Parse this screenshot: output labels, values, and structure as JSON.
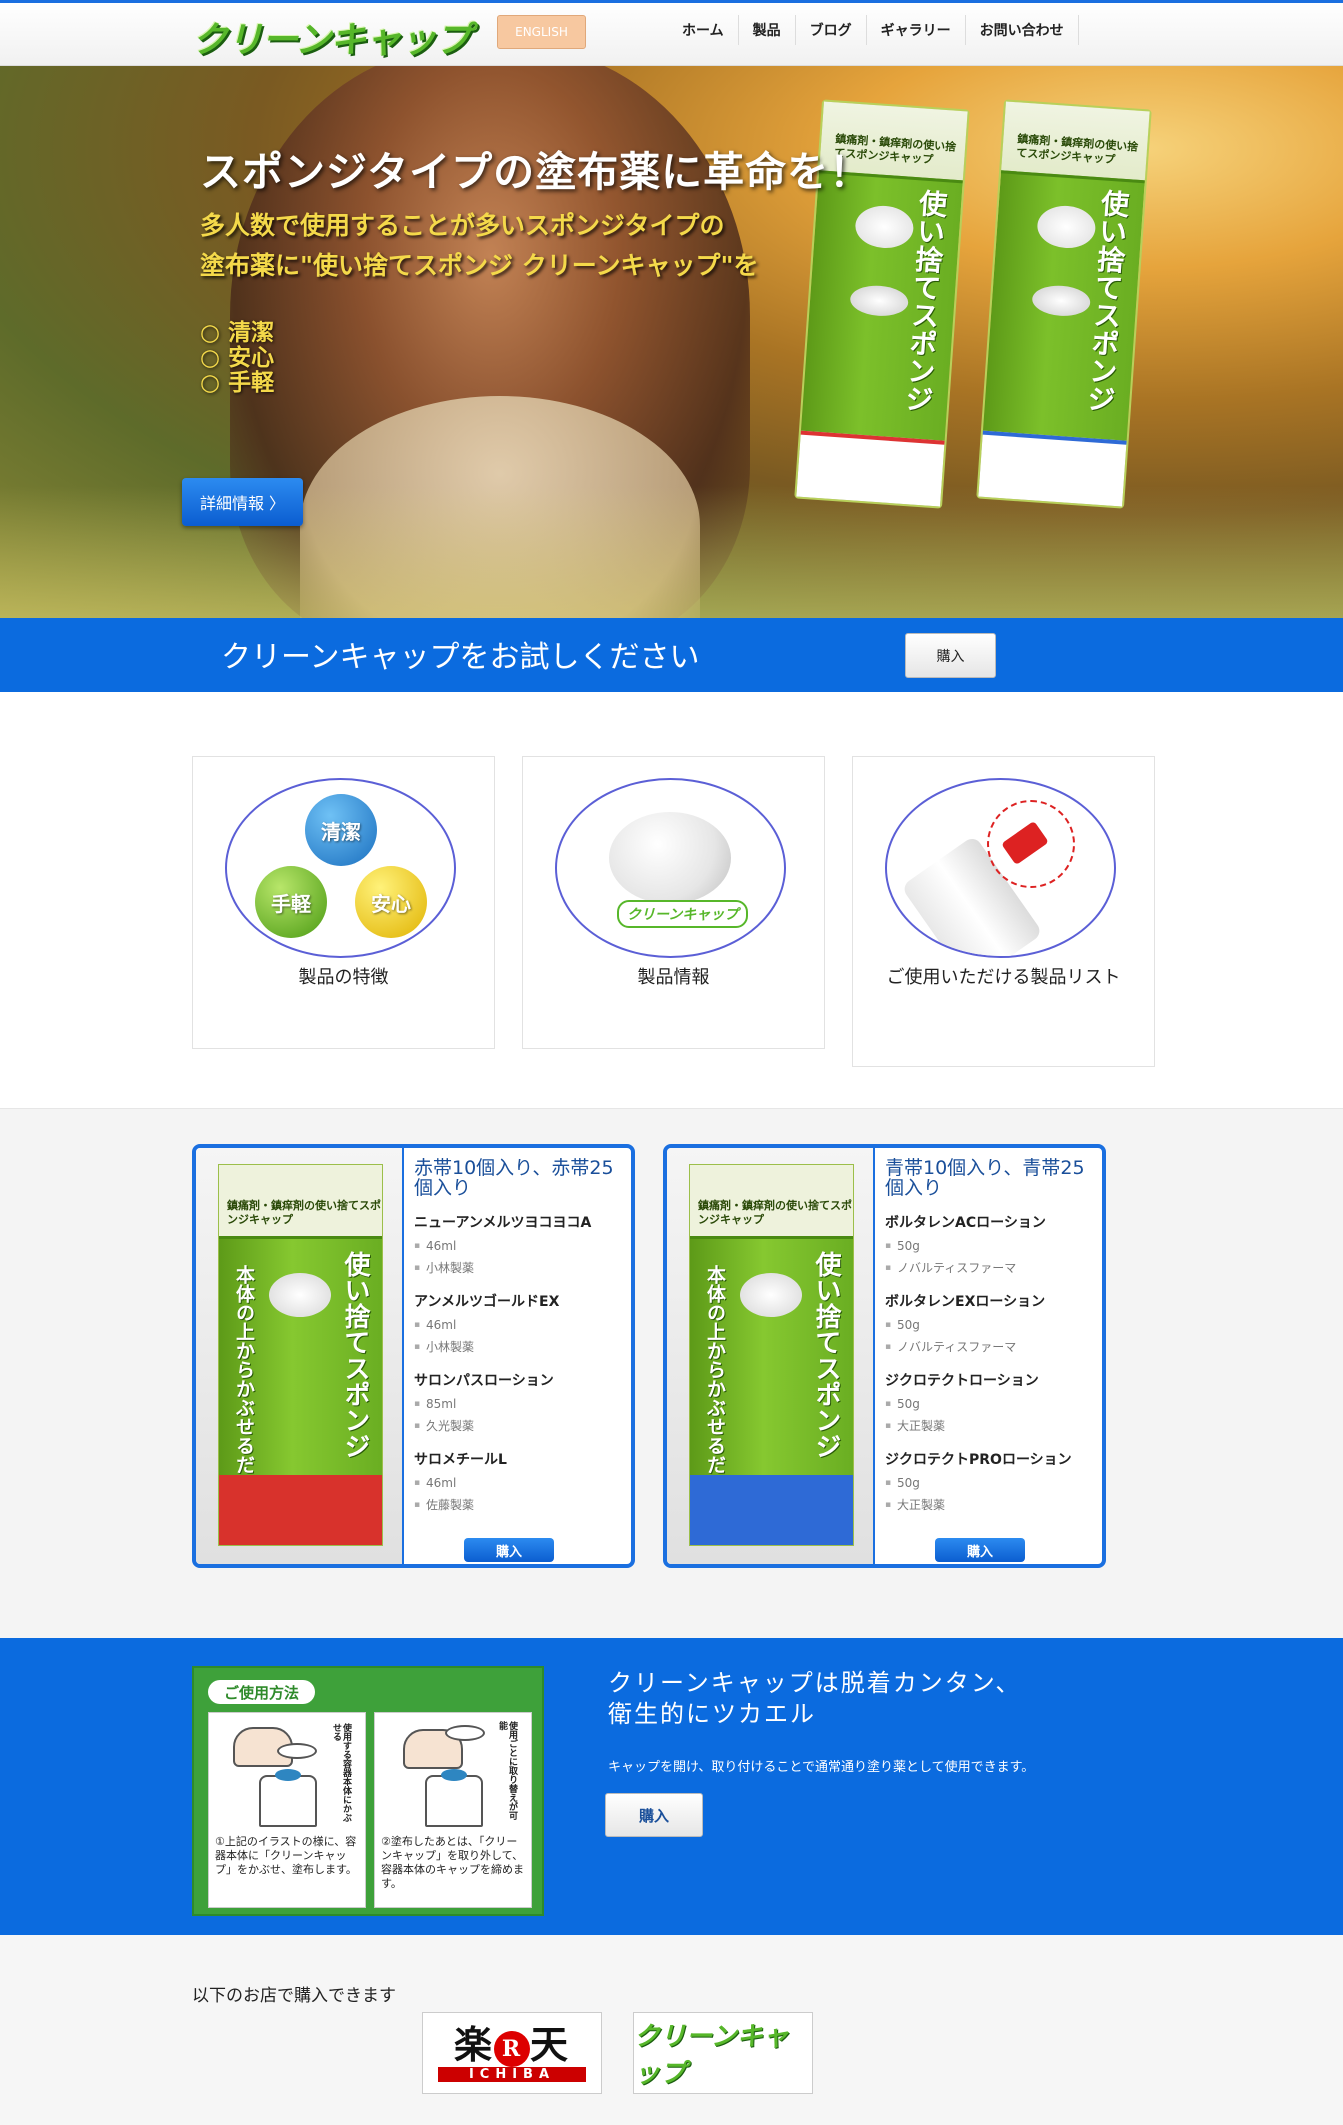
{
  "header": {
    "logo": "クリーンキャップ",
    "english_button": "ENGLISH",
    "nav": [
      "ホーム",
      "製品",
      "ブログ",
      "ギャラリー",
      "お問い合わせ"
    ]
  },
  "hero": {
    "title": "スポンジタイプの塗布薬に革命を！",
    "subtitle_line1": "多人数で使用することが多いスポンジタイプの",
    "subtitle_line2": "塗布薬に\"使い捨てスポンジ クリーンキャップ\"を",
    "features": [
      "○ 清潔",
      "○ 安心",
      "○ 手軽"
    ],
    "detail_button": "詳細情報 〉",
    "box_header": "鎮痛剤・鎮痒剤の使い捨てスポンジキャップ",
    "box_vertical": "使い捨てスポンジ"
  },
  "try_band": {
    "text": "クリーンキャップをお試しください",
    "buy_button": "購入"
  },
  "features_cards": [
    {
      "label": "製品の特徴",
      "balls": [
        "清潔",
        "手軽",
        "安心"
      ]
    },
    {
      "label": "製品情報",
      "badge": "クリーンキャップ"
    },
    {
      "label": "ご使用いただける製品リスト"
    }
  ],
  "products": [
    {
      "title": "赤帯10個入り、赤帯25個入り",
      "items": [
        {
          "name": "ニューアンメルツヨコヨコA",
          "volume": "46ml",
          "maker": "小林製薬"
        },
        {
          "name": "アンメルツゴールドEX",
          "volume": "46ml",
          "maker": "小林製薬"
        },
        {
          "name": "サロンパスローション",
          "volume": "85ml",
          "maker": "久光製薬"
        },
        {
          "name": "サロメチールL",
          "volume": "46ml",
          "maker": "佐藤製薬"
        }
      ],
      "buy": "購入",
      "box_header": "鎮痛剤・鎮痒剤の使い捨てスポンジキャップ",
      "box_vertical": "使い捨てスポンジ",
      "box_vertical2": "本体の上からかぶせるだけ"
    },
    {
      "title": "青帯10個入り、青帯25個入り",
      "items": [
        {
          "name": "ボルタレンACローション",
          "volume": "50g",
          "maker": "ノバルティスファーマ"
        },
        {
          "name": "ボルタレンEXローション",
          "volume": "50g",
          "maker": "ノバルティスファーマ"
        },
        {
          "name": "ジクロテクトローション",
          "volume": "50g",
          "maker": "大正製薬"
        },
        {
          "name": "ジクロテクトPROローション",
          "volume": "50g",
          "maker": "大正製薬"
        }
      ],
      "buy": "購入",
      "box_header": "鎮痛剤・鎮痒剤の使い捨てスポンジキャップ",
      "box_vertical": "使い捨てスポンジ",
      "box_vertical2": "本体の上からかぶせるだけ"
    }
  ],
  "usage": {
    "tag": "ご使用方法",
    "step1": "①上記のイラストの様に、容器本体に「クリーンキャップ」をかぶせ、塗布します。",
    "step2": "②塗布したあとは、「クリーンキャップ」を取り外して、容器本体のキャップを締めます。",
    "step1_note": "使用する容器本体にかぶせる",
    "step2_note": "使用ごとに取り替えが可能",
    "title_line1": "クリーンキャップは脱着カンタン、",
    "title_line2": "衛生的にツカエル",
    "description": "キャップを開け、取り付けることで通常通り塗り薬として使用できます。",
    "buy_button": "購入"
  },
  "stores": {
    "title": "以下のお店で購入できます",
    "rakuten_top_left": "楽",
    "rakuten_r": "R",
    "rakuten_top_right": "天",
    "rakuten_bottom": "ICHIBA",
    "store2": "クリーンキャップ"
  }
}
